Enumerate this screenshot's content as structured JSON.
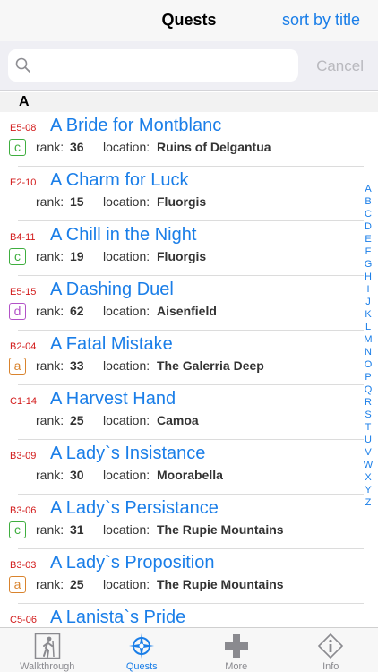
{
  "nav": {
    "title": "Quests",
    "sort_label": "sort by title"
  },
  "search": {
    "value": "",
    "placeholder": "",
    "cancel_label": "Cancel"
  },
  "section": {
    "letter": "A"
  },
  "colors": {
    "accent": "#1a7ee8",
    "code_red": "#d21a1a",
    "badge_c": "#3fae3f",
    "badge_d": "#b252c7",
    "badge_a": "#d9832d",
    "tab_inactive": "#8a8a8f"
  },
  "labels": {
    "rank": "rank:",
    "location": "location:"
  },
  "quests": [
    {
      "code": "E5-08",
      "title": "A Bride for Montblanc",
      "badge": "c",
      "rank": "36",
      "location": "Ruins of Delgantua"
    },
    {
      "code": "E2-10",
      "title": "A Charm for Luck",
      "badge": "",
      "rank": "15",
      "location": "Fluorgis"
    },
    {
      "code": "B4-11",
      "title": "A Chill in the Night",
      "badge": "c",
      "rank": "19",
      "location": "Fluorgis"
    },
    {
      "code": "E5-15",
      "title": "A Dashing Duel",
      "badge": "d",
      "rank": "62",
      "location": "Aisenfield"
    },
    {
      "code": "B2-04",
      "title": "A Fatal Mistake",
      "badge": "a",
      "rank": "33",
      "location": "The Galerria Deep"
    },
    {
      "code": "C1-14",
      "title": "A Harvest Hand",
      "badge": "",
      "rank": "25",
      "location": "Camoa"
    },
    {
      "code": "B3-09",
      "title": "A Lady`s Insistance",
      "badge": "",
      "rank": "30",
      "location": "Moorabella"
    },
    {
      "code": "B3-06",
      "title": "A Lady`s Persistance",
      "badge": "c",
      "rank": "31",
      "location": "The Rupie Mountains"
    },
    {
      "code": "B3-03",
      "title": "A Lady`s Proposition",
      "badge": "a",
      "rank": "25",
      "location": "The Rupie Mountains"
    },
    {
      "code": "C5-06",
      "title": "A Lanista`s Pride",
      "badge": "",
      "rank": "",
      "location": ""
    }
  ],
  "index_letters": [
    "A",
    "B",
    "C",
    "D",
    "E",
    "F",
    "G",
    "H",
    "I",
    "J",
    "K",
    "L",
    "M",
    "N",
    "O",
    "P",
    "Q",
    "R",
    "S",
    "T",
    "U",
    "V",
    "W",
    "X",
    "Y",
    "Z"
  ],
  "tabs": [
    {
      "label": "Walkthrough",
      "icon": "hiker-icon",
      "selected": false
    },
    {
      "label": "Quests",
      "icon": "compass-icon",
      "selected": true
    },
    {
      "label": "More",
      "icon": "plus-icon",
      "selected": false
    },
    {
      "label": "Info",
      "icon": "info-icon",
      "selected": false
    }
  ]
}
